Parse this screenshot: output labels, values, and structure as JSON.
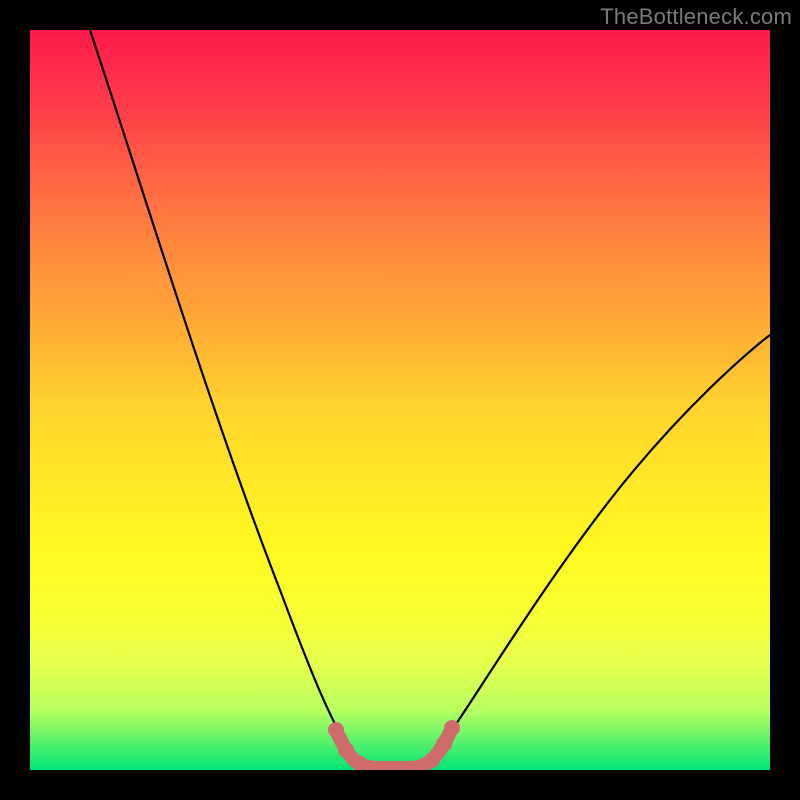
{
  "watermark": "TheBottleneck.com",
  "chart_data": {
    "type": "line",
    "title": "",
    "xlabel": "",
    "ylabel": "",
    "xlim": [
      0,
      100
    ],
    "ylim": [
      0,
      100
    ],
    "grid": false,
    "legend": false,
    "series": [
      {
        "name": "bottleneck-curve",
        "color": "#000000",
        "x": [
          10,
          15,
          20,
          25,
          30,
          35,
          38,
          40,
          42,
          44,
          46,
          50,
          55,
          60,
          65,
          70,
          75,
          80,
          85,
          90,
          95,
          100
        ],
        "y": [
          100,
          88,
          76,
          62,
          48,
          32,
          18,
          10,
          4,
          1,
          0,
          0,
          4,
          10,
          18,
          26,
          34,
          41,
          47,
          52,
          56,
          58
        ]
      },
      {
        "name": "floor-highlight",
        "color": "#d46a6a",
        "x": [
          40,
          42,
          44,
          46,
          48,
          50,
          52,
          54
        ],
        "y": [
          6,
          2,
          0,
          0,
          0,
          0,
          1,
          3
        ]
      }
    ],
    "annotations": []
  }
}
